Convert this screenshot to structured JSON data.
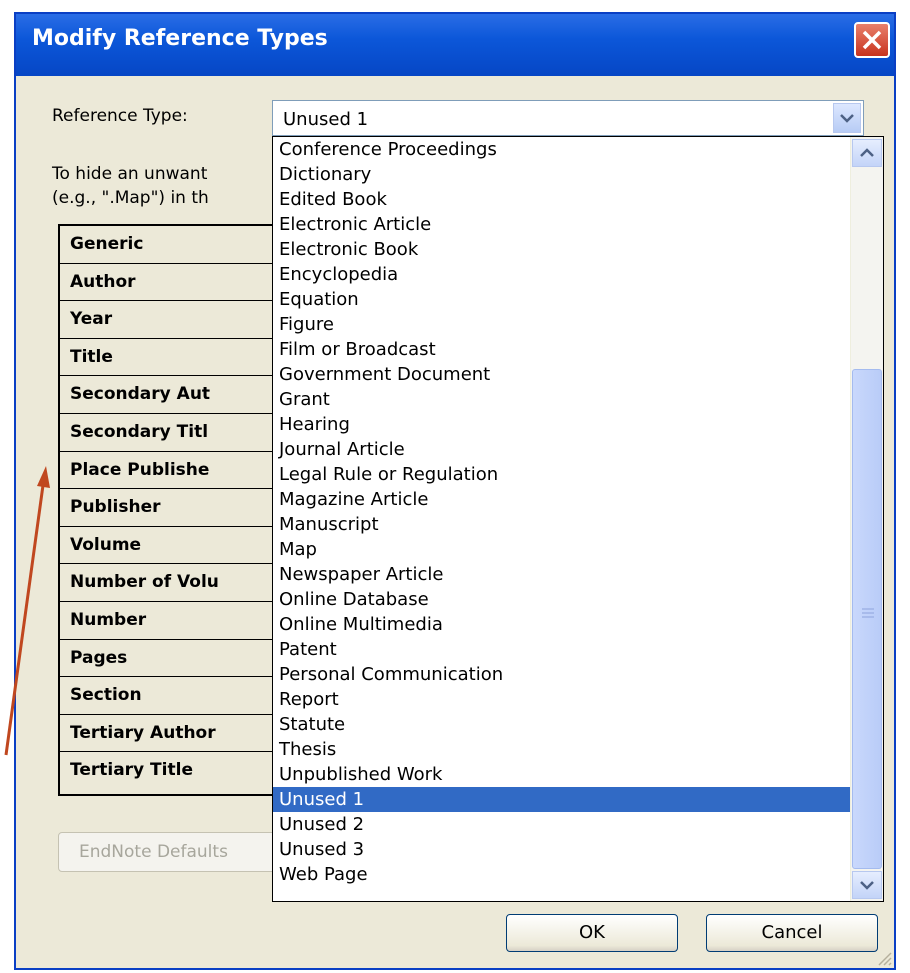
{
  "window": {
    "title": "Modify Reference Types"
  },
  "reference_type": {
    "label": "Reference Type:",
    "value": "Unused 1"
  },
  "instructions": {
    "line1": "To hide an unwant",
    "line2": "(e.g., \".Map\") in th"
  },
  "field_table": {
    "rows": [
      "Generic",
      "Author",
      "Year",
      "Title",
      "Secondary Aut",
      "Secondary Titl",
      "Place Publishe",
      "Publisher",
      "Volume",
      "Number of Volu",
      "Number",
      "Pages",
      "Section",
      "Tertiary Author",
      "Tertiary Title"
    ]
  },
  "dropdown": {
    "items": [
      "Conference Proceedings",
      "Dictionary",
      "Edited Book",
      "Electronic Article",
      "Electronic Book",
      "Encyclopedia",
      "Equation",
      "Figure",
      "Film or Broadcast",
      "Government Document",
      "Grant",
      "Hearing",
      "Journal Article",
      "Legal Rule or Regulation",
      "Magazine Article",
      "Manuscript",
      "Map",
      "Newspaper Article",
      "Online Database",
      "Online Multimedia",
      "Patent",
      "Personal Communication",
      "Report",
      "Statute",
      "Thesis",
      "Unpublished Work",
      "Unused 1",
      "Unused 2",
      "Unused 3",
      "Web Page"
    ],
    "selected": "Unused 1"
  },
  "buttons": {
    "defaults_label": "EndNote Defaults",
    "ok_label": "OK",
    "cancel_label": "Cancel"
  },
  "colors": {
    "titlebar": "#0c57d9",
    "selection": "#316ac5",
    "annotation_arrow": "#c0471f",
    "dialog_bg": "#ece9d8"
  }
}
